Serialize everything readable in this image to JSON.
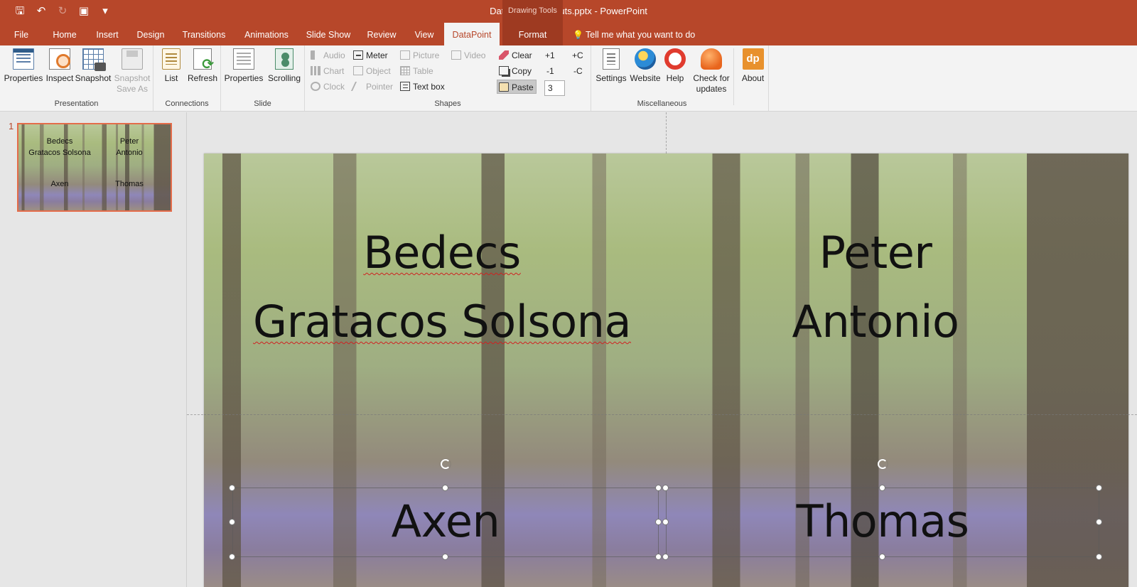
{
  "titlebar": {
    "title": "DataPoint Shortcuts.pptx - PowerPoint",
    "context_group": "Drawing Tools",
    "qat": [
      "save-icon",
      "undo-icon",
      "redo-icon",
      "present-icon",
      "customize-icon"
    ]
  },
  "tabs": [
    "File",
    "Home",
    "Insert",
    "Design",
    "Transitions",
    "Animations",
    "Slide Show",
    "Review",
    "View",
    "DataPoint",
    "Format"
  ],
  "tellme": "Tell me what you want to do",
  "ribbon": {
    "presentation": {
      "label": "Presentation",
      "buttons": [
        "Properties",
        "Inspect",
        "Snapshot",
        "Snapshot",
        "Save As"
      ]
    },
    "connections": {
      "label": "Connections",
      "buttons": [
        "List",
        "Refresh"
      ]
    },
    "slide": {
      "label": "Slide",
      "buttons": [
        "Properties",
        "Scrolling"
      ]
    },
    "shapes": {
      "label": "Shapes",
      "col1": [
        "Audio",
        "Chart",
        "Clock"
      ],
      "col2": [
        "Meter",
        "Object",
        "Pointer"
      ],
      "col3": [
        "Picture",
        "Table",
        "Text box"
      ],
      "col4": [
        "Video"
      ],
      "edit": [
        "Clear",
        "Copy",
        "Paste"
      ],
      "step": [
        "+1",
        "-1",
        "+C",
        "-C"
      ],
      "stepper_value": "3"
    },
    "misc": {
      "label": "Miscellaneous",
      "buttons": [
        "Settings",
        "Website",
        "Help",
        "Check for",
        "updates",
        "About"
      ],
      "about_icon_text": "dp"
    }
  },
  "thumbnails": {
    "slide_number": "1",
    "texts": [
      "Bedecs",
      "Gratacos Solsona",
      "Peter",
      "Antonio",
      "Axen",
      "Thomas"
    ]
  },
  "slide": {
    "top_left": [
      "Bedecs",
      "Gratacos Solsona"
    ],
    "top_right": [
      "Peter",
      "Antonio"
    ],
    "bottom_left": "Axen",
    "bottom_right": "Thomas"
  }
}
